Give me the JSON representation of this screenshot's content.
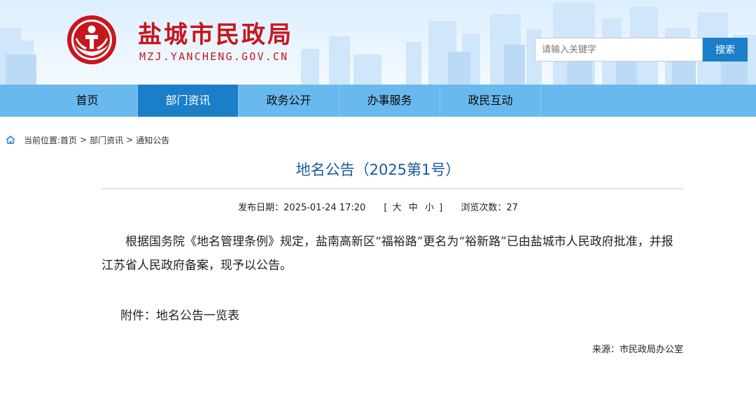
{
  "header": {
    "site_title": "盐城市民政局",
    "site_domain": "MZJ.YANCHENG.GOV.CN",
    "search_placeholder": "请输入关键字",
    "search_button": "搜索"
  },
  "nav": {
    "items": [
      {
        "label": "首页"
      },
      {
        "label": "部门资讯",
        "active": true
      },
      {
        "label": "政务公开"
      },
      {
        "label": "办事服务"
      },
      {
        "label": "政民互动"
      }
    ]
  },
  "breadcrumb": {
    "prefix": "当前位置:",
    "items": [
      "首页",
      "部门资讯",
      "通知公告"
    ],
    "separator": ">"
  },
  "article": {
    "title": "地名公告（2025第1号）",
    "publish_label": "发布日期：",
    "publish_date": "2025-01-24 17:20",
    "font_size_open": "[",
    "font_size_large": "大",
    "font_size_medium": "中",
    "font_size_small": "小",
    "font_size_close": "]",
    "views_label": "浏览次数：",
    "views": "27",
    "body": "根据国务院《地名管理条例》规定，盐南高新区“福裕路”更名为“裕新路”已由盐城市人民政府批准，并报江苏省人民政府备案，现予以公告。",
    "attachment_label": "附件：",
    "attachment_name": "地名公告一览表",
    "source_label": "来源：",
    "source": "市民政局办公室"
  },
  "colors": {
    "brand_red": "#c8161d",
    "nav_bg": "#69b9ee",
    "nav_active": "#1a7ec8",
    "title_blue": "#1a5a9e"
  }
}
